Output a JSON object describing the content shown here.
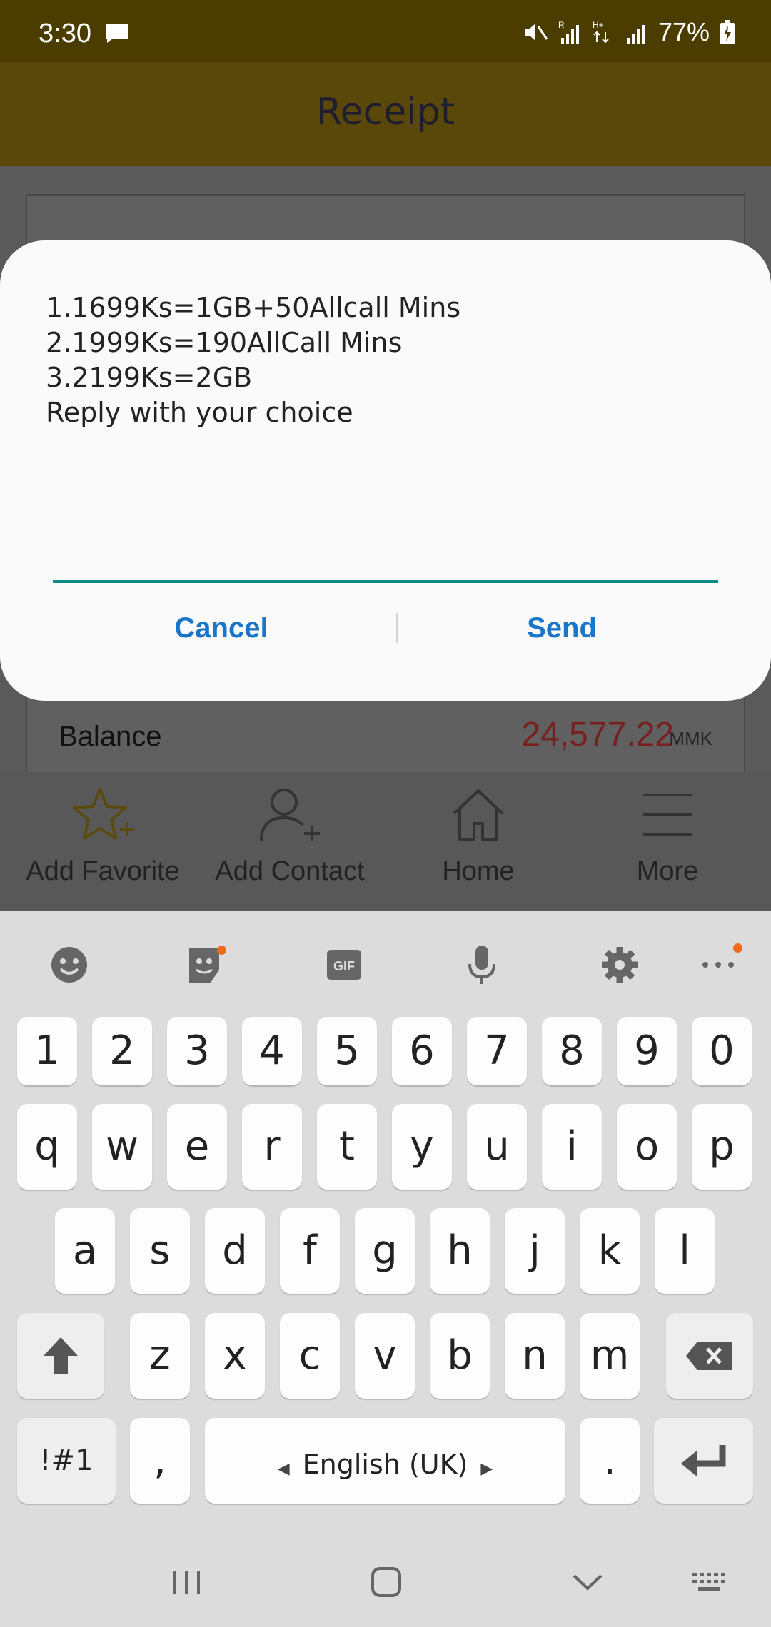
{
  "status_bar": {
    "time": "3:30",
    "battery": "77%",
    "icons": [
      "message-icon",
      "mute-icon",
      "signal-icon",
      "data-icon",
      "battery-icon"
    ]
  },
  "app_bar": {
    "title": "Receipt"
  },
  "receipt": {
    "balance_label": "Balance",
    "balance_value": "24,577.22",
    "balance_currency": "MMK"
  },
  "bottom_nav": {
    "items": [
      {
        "label": "Add Favorite",
        "icon": "star-plus-icon"
      },
      {
        "label": "Add Contact",
        "icon": "person-plus-icon"
      },
      {
        "label": "Home",
        "icon": "home-icon"
      },
      {
        "label": "More",
        "icon": "menu-icon"
      }
    ]
  },
  "dialog": {
    "lines": [
      "1.1699Ks=1GB+50Allcall Mins",
      "2.1999Ks=190AllCall Mins",
      "3.2199Ks=2GB",
      "Reply with your choice"
    ],
    "input_value": "",
    "cancel_label": "Cancel",
    "send_label": "Send"
  },
  "keyboard": {
    "toolbar": [
      "emoji-icon",
      "sticker-icon",
      "gif-icon",
      "microphone-icon",
      "settings-icon",
      "more-icon"
    ],
    "row_numbers": [
      "1",
      "2",
      "3",
      "4",
      "5",
      "6",
      "7",
      "8",
      "9",
      "0"
    ],
    "row_top": [
      "q",
      "w",
      "e",
      "r",
      "t",
      "y",
      "u",
      "i",
      "o",
      "p"
    ],
    "row_middle": [
      "a",
      "s",
      "d",
      "f",
      "g",
      "h",
      "j",
      "k",
      "l"
    ],
    "row_bottom": [
      "z",
      "x",
      "c",
      "v",
      "b",
      "n",
      "m"
    ],
    "symbols_label": "!#1",
    "comma_label": ",",
    "space_label": "English (UK)",
    "period_label": ".",
    "accent_color": "#f06a1e"
  },
  "colors": {
    "status_bar": "#4b3d00",
    "app_bar": "#5a480a",
    "dialog_button": "#1976c8",
    "input_underline": "#0f8a84",
    "balance_value": "#7a1f1f"
  }
}
